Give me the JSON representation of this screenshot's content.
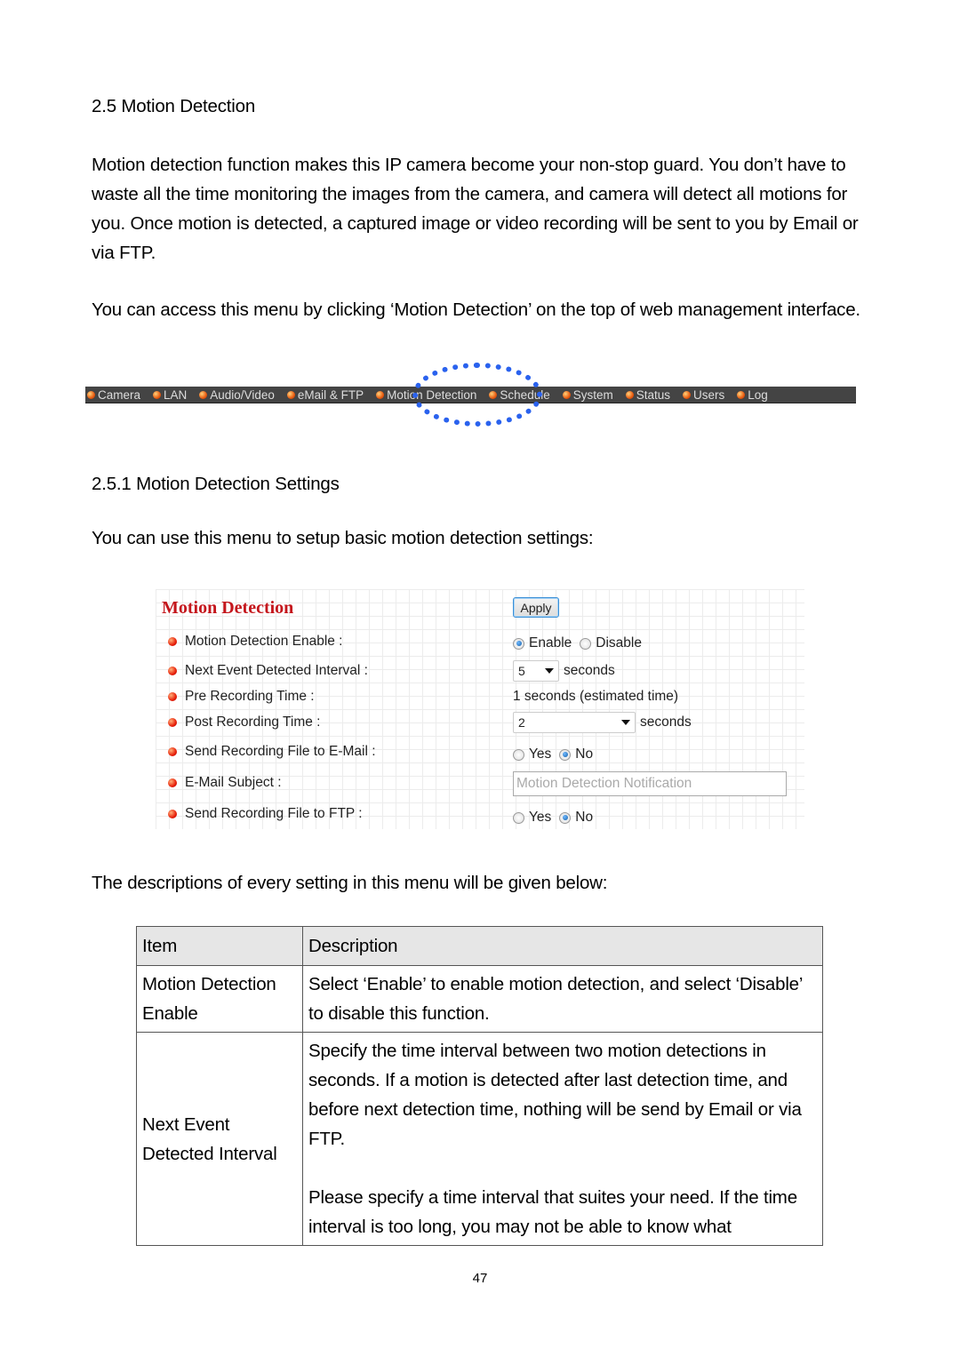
{
  "section_heading": "2.5 Motion Detection",
  "intro_paragraph": "Motion detection function makes this IP camera become your non-stop guard. You don’t have to waste all the time monitoring the images from the camera, and camera will detect all motions for you. Once motion is detected, a captured image or video recording will be sent to you by Email or via FTP.",
  "access_paragraph": "You can access this menu by clicking ‘Motion Detection’ on the top of web management interface.",
  "navbar": {
    "items": [
      "Camera",
      "LAN",
      "Audio/Video",
      "eMail & FTP",
      "Motion Detection",
      "Schedule",
      "System",
      "Status",
      "Users",
      "Log"
    ],
    "highlighted": "Motion Detection",
    "highlight_color": "#2a62ee"
  },
  "subsection_heading": "2.5.1 Motion Detection Settings",
  "subsection_intro": "You can use this menu to setup basic motion detection settings:",
  "panel": {
    "title": "Motion Detection",
    "apply_label": "Apply",
    "rows": [
      {
        "label": "Motion Detection Enable :"
      },
      {
        "label": "Next Event Detected Interval :"
      },
      {
        "label": "Pre Recording Time :"
      },
      {
        "label": "Post Recording Time :"
      },
      {
        "label": "Send Recording File to E-Mail :"
      },
      {
        "label": "E-Mail Subject :"
      },
      {
        "label": "Send Recording File to FTP :"
      }
    ],
    "enable_radio": {
      "options": [
        "Enable",
        "Disable"
      ],
      "selected": "Enable"
    },
    "interval": {
      "value": "5",
      "unit": "seconds"
    },
    "pre_recording": "1 seconds (estimated time)",
    "post_recording": {
      "value": "2",
      "unit": "seconds"
    },
    "send_email_radio": {
      "options": [
        "Yes",
        "No"
      ],
      "selected": "No"
    },
    "email_subject": {
      "placeholder": "Motion Detection Notification"
    },
    "send_ftp_radio": {
      "options": [
        "Yes",
        "No"
      ],
      "selected": "No"
    }
  },
  "table_intro": "The descriptions of every setting in this menu will be given below:",
  "table": {
    "headers": [
      "Item",
      "Description"
    ],
    "rows": [
      {
        "item": "Motion Detection Enable",
        "description": [
          "Select ‘Enable’ to enable motion detection, and select ‘Disable’ to disable this function."
        ]
      },
      {
        "item": "Next Event Detected Interval",
        "description": [
          "Specify the time interval between two motion detections in seconds. If a motion is detected after last detection time, and before next detection time, nothing will be send by Email or via FTP.",
          "Please specify a time interval that suites your need. If the time interval is too long, you may not be able to know what"
        ]
      }
    ]
  },
  "page_number": "47"
}
